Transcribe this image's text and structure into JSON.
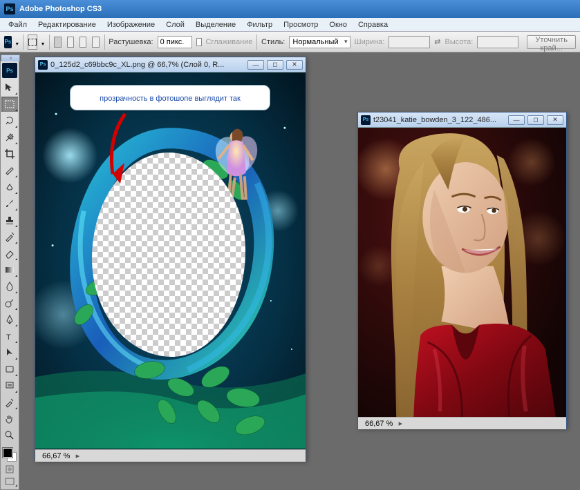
{
  "app": {
    "title": "Adobe Photoshop CS3",
    "logo": "Ps"
  },
  "menu": [
    "Файл",
    "Редактирование",
    "Изображение",
    "Слой",
    "Выделение",
    "Фильтр",
    "Просмотр",
    "Окно",
    "Справка"
  ],
  "options": {
    "feather_label": "Растушевка:",
    "feather_value": "0 пикс.",
    "antialias_label": "Сглаживание",
    "style_label": "Стиль:",
    "style_value": "Нормальный",
    "width_label": "Ширина:",
    "height_label": "Высота:",
    "refine_btn": "Уточнить край..."
  },
  "tools": [
    {
      "name": "move",
      "icon": "move"
    },
    {
      "name": "marquee",
      "icon": "marquee",
      "active": true
    },
    {
      "name": "lasso",
      "icon": "lasso"
    },
    {
      "name": "wand",
      "icon": "wand"
    },
    {
      "name": "crop",
      "icon": "crop"
    },
    {
      "name": "slice",
      "icon": "slice"
    },
    {
      "name": "heal",
      "icon": "heal"
    },
    {
      "name": "brush",
      "icon": "brush"
    },
    {
      "name": "stamp",
      "icon": "stamp"
    },
    {
      "name": "history",
      "icon": "history"
    },
    {
      "name": "eraser",
      "icon": "eraser"
    },
    {
      "name": "gradient",
      "icon": "gradient"
    },
    {
      "name": "blur",
      "icon": "blur"
    },
    {
      "name": "dodge",
      "icon": "dodge"
    },
    {
      "name": "pen",
      "icon": "pen"
    },
    {
      "name": "type",
      "icon": "type"
    },
    {
      "name": "path",
      "icon": "path"
    },
    {
      "name": "shape",
      "icon": "shape"
    },
    {
      "name": "notes",
      "icon": "notes"
    },
    {
      "name": "eyedrop",
      "icon": "eyedrop"
    },
    {
      "name": "hand",
      "icon": "hand"
    },
    {
      "name": "zoom",
      "icon": "zoom"
    }
  ],
  "doc1": {
    "title": "0_125d2_c69bbc9c_XL.png @ 66,7% (Слой 0, R...",
    "zoom": "66,67 %",
    "callout": "прозрачность в фотошопе выглядит так"
  },
  "doc2": {
    "title": "t23041_katie_bowden_3_122_486...",
    "zoom": "66,67 %"
  }
}
